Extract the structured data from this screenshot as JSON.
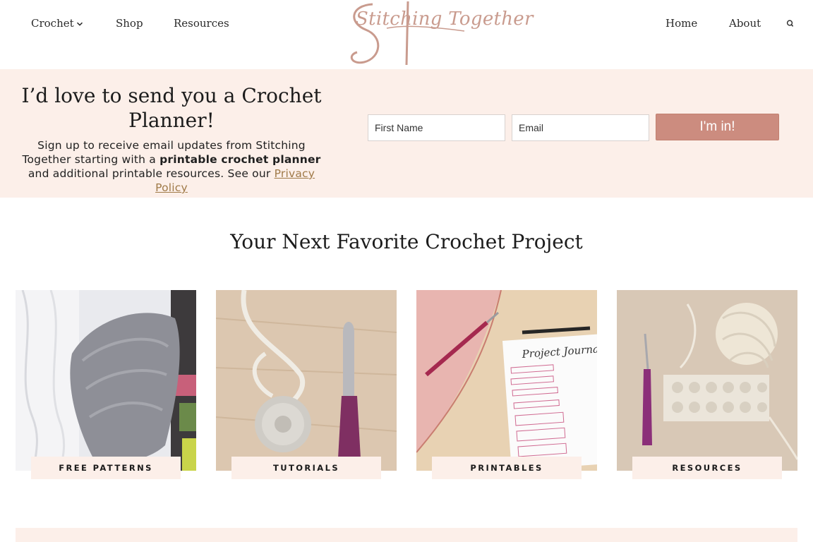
{
  "header": {
    "nav_left": [
      {
        "label": "Crochet",
        "has_dropdown": true
      },
      {
        "label": "Shop"
      },
      {
        "label": "Resources"
      }
    ],
    "logo_text": "Stitching Together",
    "nav_right": [
      {
        "label": "Home"
      },
      {
        "label": "About"
      }
    ],
    "search_icon": "search-icon"
  },
  "signup": {
    "title": "I’d love to send you a Crochet Planner!",
    "text_before": "Sign up to receive email updates from Stitching Together starting with a ",
    "text_bold": "printable crochet planner",
    "text_after": " and additional printable resources. See our ",
    "privacy_link": "Privacy Policy",
    "first_name_placeholder": "First Name",
    "email_placeholder": "Email",
    "submit_label": "I'm in!",
    "background_color": "#fcefe9",
    "button_color": "#cc8c7f"
  },
  "projects": {
    "title": "Your Next Favorite Crochet Project",
    "cards": [
      {
        "label": "FREE PATTERNS",
        "image": "gray-crochet-shawl-photo"
      },
      {
        "label": "TUTORIALS",
        "image": "crochet-magic-ring-with-hook-photo"
      },
      {
        "label": "PRINTABLES",
        "image": "project-journal-printable-photo"
      },
      {
        "label": "RESOURCES",
        "image": "yarn-ball-and-swatch-photo"
      }
    ]
  }
}
